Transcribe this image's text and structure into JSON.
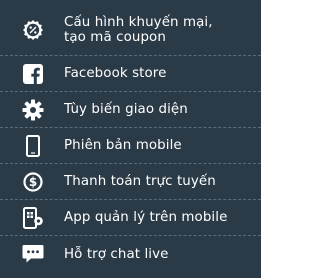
{
  "menu": {
    "items": [
      {
        "id": "coupon",
        "label_lines": [
          "Cấu hình khuyến mại,",
          "tạo mã coupon"
        ],
        "icon": "coupon-badge-icon"
      },
      {
        "id": "facebook",
        "label": "Facebook store",
        "icon": "facebook-icon"
      },
      {
        "id": "theme",
        "label": "Tùy biến giao diện",
        "icon": "gear-icon"
      },
      {
        "id": "mobile",
        "label": "Phiên bản mobile",
        "icon": "mobile-phone-icon"
      },
      {
        "id": "payment",
        "label": "Thanh toán trực tuyến",
        "icon": "dollar-circle-icon"
      },
      {
        "id": "app",
        "label": "App quản lý trên mobile",
        "icon": "mobile-app-icon"
      },
      {
        "id": "chat",
        "label": "Hỗ trợ chat live",
        "icon": "chat-bubble-icon"
      }
    ]
  },
  "colors": {
    "panel_background": "#2b3a47",
    "divider": "#5b6b78",
    "text": "#ffffff"
  }
}
